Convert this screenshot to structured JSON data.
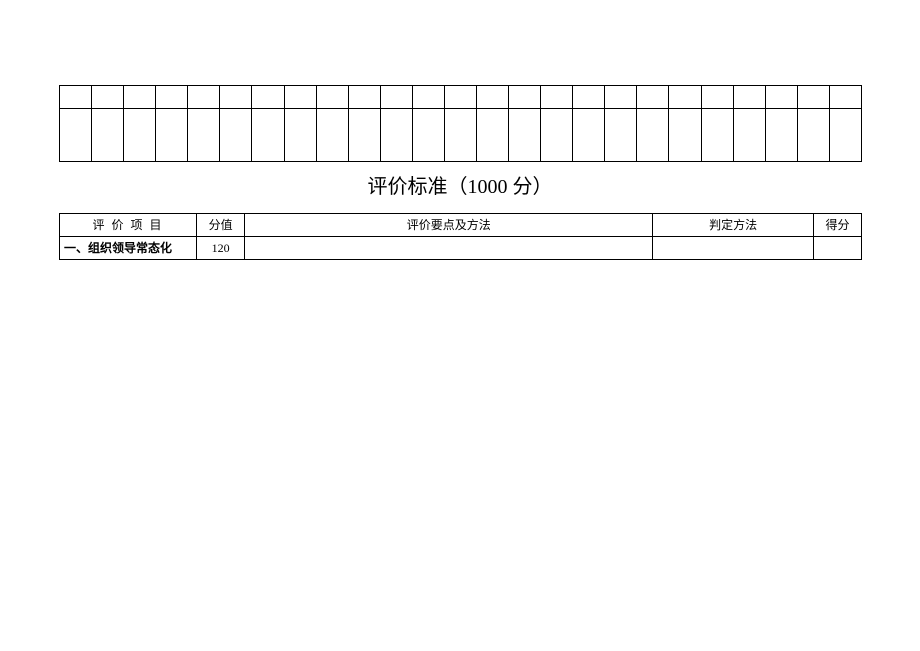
{
  "title": "评价标准（1000 分）",
  "upper_grid": {
    "cols": 25,
    "rows": 2
  },
  "eval_table": {
    "headers": {
      "item": "评 价 项 目",
      "score_value": "分值",
      "points_method": "评价要点及方法",
      "judge_method": "判定方法",
      "score": "得分"
    },
    "rows": [
      {
        "item": "一、组织领导常态化",
        "score_value": "120",
        "points_method": "",
        "judge_method": "",
        "score": ""
      }
    ]
  }
}
